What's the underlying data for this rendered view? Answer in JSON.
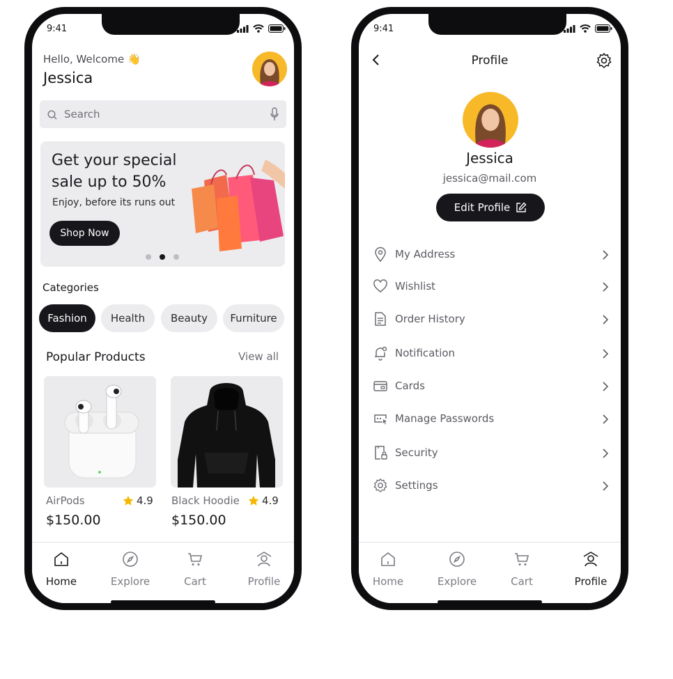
{
  "status": {
    "time": "9:41"
  },
  "home": {
    "greeting": "Hello, Welcome 👋",
    "user_name": "Jessica",
    "search": {
      "placeholder": "Search"
    },
    "banner": {
      "title": "Get your special sale up to 50%",
      "subtitle": "Enjoy, before its runs out",
      "button": "Shop Now",
      "active_dot": 2
    },
    "categories_title": "Categories",
    "categories": [
      {
        "label": "Fashion",
        "active": true
      },
      {
        "label": "Health",
        "active": false
      },
      {
        "label": "Beauty",
        "active": false
      },
      {
        "label": "Furniture",
        "active": false
      }
    ],
    "popular_title": "Popular Products",
    "view_all": "View all",
    "products": [
      {
        "name": "AirPods",
        "rating": "4.9",
        "price": "$150.00",
        "image_icon": "airpods-image"
      },
      {
        "name": "Black Hoodie",
        "rating": "4.9",
        "price": "$150.00",
        "image_icon": "hoodie-image"
      }
    ]
  },
  "profile": {
    "header_title": "Profile",
    "name": "Jessica",
    "email": "jessica@mail.com",
    "edit_button": "Edit Profile",
    "menu": [
      {
        "label": "My Address",
        "icon": "location-pin-icon"
      },
      {
        "label": "Wishlist",
        "icon": "heart-icon"
      },
      {
        "label": "Order History",
        "icon": "document-icon"
      },
      {
        "label": "Notification",
        "icon": "bell-icon"
      },
      {
        "label": "Cards",
        "icon": "card-icon"
      },
      {
        "label": "Manage Passwords",
        "icon": "password-icon"
      },
      {
        "label": "Security",
        "icon": "security-icon"
      },
      {
        "label": "Settings",
        "icon": "gear-icon"
      }
    ]
  },
  "tabbar": {
    "tabs": [
      {
        "label": "Home",
        "icon": "home-icon"
      },
      {
        "label": "Explore",
        "icon": "compass-icon"
      },
      {
        "label": "Cart",
        "icon": "cart-icon"
      },
      {
        "label": "Profile",
        "icon": "profile-icon"
      }
    ],
    "home_active": "Home",
    "profile_active": "Profile"
  },
  "colors": {
    "dark": "#17171b",
    "avatar_bg": "#f7b928",
    "star": "#f5b800",
    "surface": "#ececef"
  }
}
